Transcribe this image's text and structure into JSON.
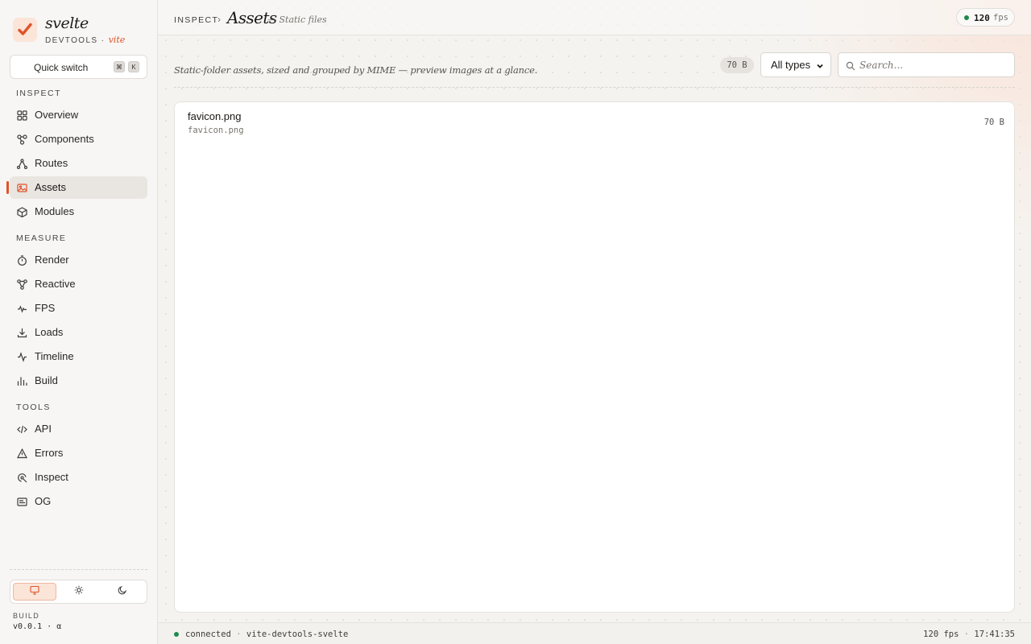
{
  "brand": {
    "name": "svelte",
    "sub": "DEVTOOLS",
    "sub_sep": "·",
    "flavor": "vite",
    "accent": "#e0532b"
  },
  "quick_switch": {
    "label": "Quick switch",
    "keys": [
      "⌘",
      "K"
    ]
  },
  "sidebar": {
    "sections": [
      {
        "label": "INSPECT",
        "items": [
          {
            "label": "Overview",
            "icon": "grid-icon"
          },
          {
            "label": "Components",
            "icon": "components-icon"
          },
          {
            "label": "Routes",
            "icon": "routes-icon"
          },
          {
            "label": "Assets",
            "icon": "image-icon",
            "active": true
          },
          {
            "label": "Modules",
            "icon": "cube-icon"
          }
        ]
      },
      {
        "label": "MEASURE",
        "items": [
          {
            "label": "Render",
            "icon": "stopwatch-icon"
          },
          {
            "label": "Reactive",
            "icon": "graph-icon"
          },
          {
            "label": "FPS",
            "icon": "pulse-icon"
          },
          {
            "label": "Loads",
            "icon": "download-icon"
          },
          {
            "label": "Timeline",
            "icon": "activity-icon"
          },
          {
            "label": "Build",
            "icon": "bar-chart-icon"
          }
        ]
      },
      {
        "label": "TOOLS",
        "items": [
          {
            "label": "API",
            "icon": "code-icon"
          },
          {
            "label": "Errors",
            "icon": "warning-icon"
          },
          {
            "label": "Inspect",
            "icon": "inspect-icon"
          },
          {
            "label": "OG",
            "icon": "card-icon"
          }
        ]
      }
    ],
    "theme_options": [
      "monitor-icon",
      "sun-icon",
      "moon-icon"
    ],
    "active_theme": "monitor-icon",
    "build": {
      "label": "BUILD",
      "version": "v0.0.1",
      "sep": "·",
      "suffix": "α"
    }
  },
  "header": {
    "crumb": "INSPECT",
    "crumb_sep": "›",
    "title": "Assets",
    "subtitle": "— Static files",
    "fps": {
      "value": "120",
      "unit": "fps",
      "status_color": "#1f8a4c"
    }
  },
  "toolbar": {
    "description": "Static-folder assets, sized and grouped by MIME — preview images at a glance.",
    "total_size": "70 B",
    "type_filter": {
      "selected": "All types"
    },
    "search": {
      "placeholder": "Search...",
      "value": ""
    }
  },
  "assets": [
    {
      "name": "favicon.png",
      "path": "favicon.png",
      "size": "70 B"
    }
  ],
  "statusbar": {
    "connection": "connected",
    "sep": "·",
    "project": "vite-devtools-svelte",
    "fps": "120 fps",
    "time": "17:41:35"
  }
}
